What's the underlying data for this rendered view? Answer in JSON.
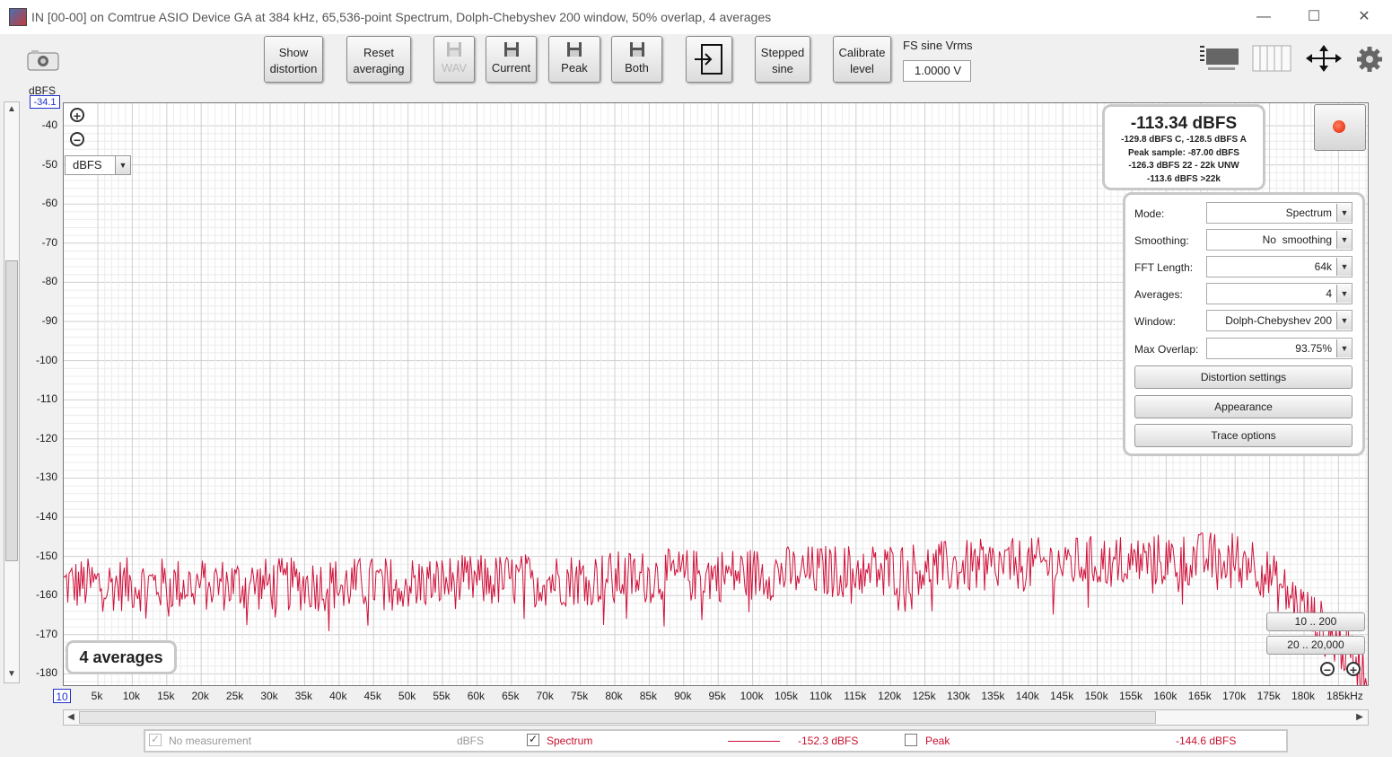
{
  "window": {
    "title": "IN [00-00] on Comtrue ASIO Device GA  at 384 kHz, 65,536-point Spectrum, Dolph-Chebyshev 200 window, 50% overlap, 4 averages",
    "minimize": "—",
    "maximize": "☐",
    "close": "✕"
  },
  "toolbar": {
    "show_distortion": "Show\ndistortion",
    "reset_averaging": "Reset\naveraging",
    "wav": "WAV",
    "current": "Current",
    "peak": "Peak",
    "both": "Both",
    "stepped_sine": "Stepped\nsine",
    "calibrate_level": "Calibrate\nlevel",
    "fs_label": "FS sine Vrms",
    "fs_value": "1.0000 V"
  },
  "plot": {
    "y_unit": "dBFS",
    "y_top": "-34.1",
    "y_ticks": [
      "-40",
      "-50",
      "-60",
      "-70",
      "-80",
      "-90",
      "-100",
      "-110",
      "-120",
      "-130",
      "-140",
      "-150",
      "-160",
      "-170",
      "-180"
    ],
    "x_start": "10",
    "x_ticks": [
      "5k",
      "10k",
      "15k",
      "20k",
      "25k",
      "30k",
      "35k",
      "40k",
      "45k",
      "50k",
      "55k",
      "60k",
      "65k",
      "70k",
      "75k",
      "80k",
      "85k",
      "90k",
      "95k",
      "100k",
      "105k",
      "110k",
      "115k",
      "120k",
      "125k",
      "130k",
      "135k",
      "140k",
      "145k",
      "150k",
      "155k",
      "160k",
      "165k",
      "170k",
      "175k",
      "180k",
      "185kHz"
    ],
    "unit_select": "dBFS",
    "averages_badge": "4 averages",
    "zoom_in": "+",
    "zoom_out": "−",
    "trace_color": "#d0103a"
  },
  "readout": {
    "main": "-113.34 dBFS",
    "line1": "-129.8 dBFS C, -128.5 dBFS A",
    "line2": "Peak sample: -87.00 dBFS",
    "line3": "-126.3 dBFS 22 - 22k UNW",
    "line4": "-113.6 dBFS >22k"
  },
  "settings": {
    "mode_label": "Mode:",
    "mode_value": "Spectrum",
    "smoothing_label": "Smoothing:",
    "smoothing_value": "No  smoothing",
    "fft_label": "FFT Length:",
    "fft_value": "64k",
    "averages_label": "Averages:",
    "averages_value": "4",
    "window_label": "Window:",
    "window_value": "Dolph-Chebyshev 200",
    "overlap_label": "Max Overlap:",
    "overlap_value": "93.75%",
    "distortion_settings": "Distortion settings",
    "appearance": "Appearance",
    "trace_options": "Trace options"
  },
  "range": {
    "btn1": "10 .. 200",
    "btn2": "20 .. 20,000"
  },
  "legend": {
    "no_measurement": "No measurement",
    "no_measurement_unit": "dBFS",
    "spectrum": "Spectrum",
    "spectrum_value": "-152.3 dBFS",
    "peak": "Peak",
    "peak_value": "-144.6 dBFS"
  }
}
